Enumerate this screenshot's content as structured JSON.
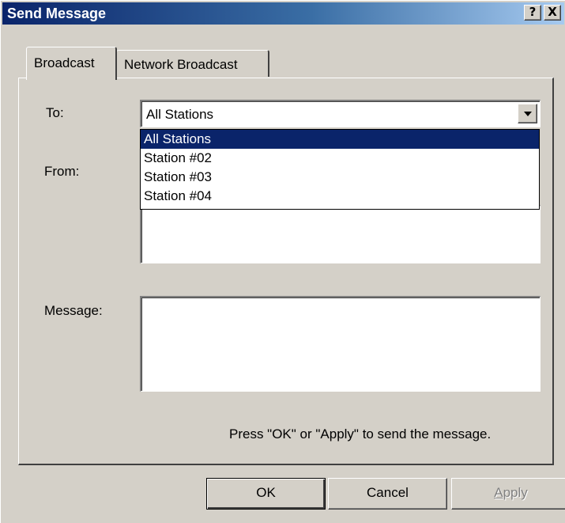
{
  "window": {
    "title": "Send Message",
    "help_glyph": "?",
    "close_glyph": "X"
  },
  "tabs": [
    {
      "label": "Broadcast",
      "active": true
    },
    {
      "label": "Network Broadcast",
      "active": false
    }
  ],
  "form": {
    "to_label": "To:",
    "to_value": "All Stations",
    "from_label": "From:",
    "message_label": "Message:",
    "message_value": ""
  },
  "dropdown": {
    "options": [
      "All Stations",
      "Station #02",
      "Station #03",
      "Station #04"
    ],
    "selected": "All Stations"
  },
  "hint": "Press \"OK\" or \"Apply\" to send the message.",
  "buttons": {
    "ok": "OK",
    "cancel": "Cancel",
    "apply_first": "A",
    "apply_rest": "pply"
  },
  "colors": {
    "title_bar": "#0a246a",
    "selection": "#0a246a",
    "face": "#d4d0c8"
  }
}
